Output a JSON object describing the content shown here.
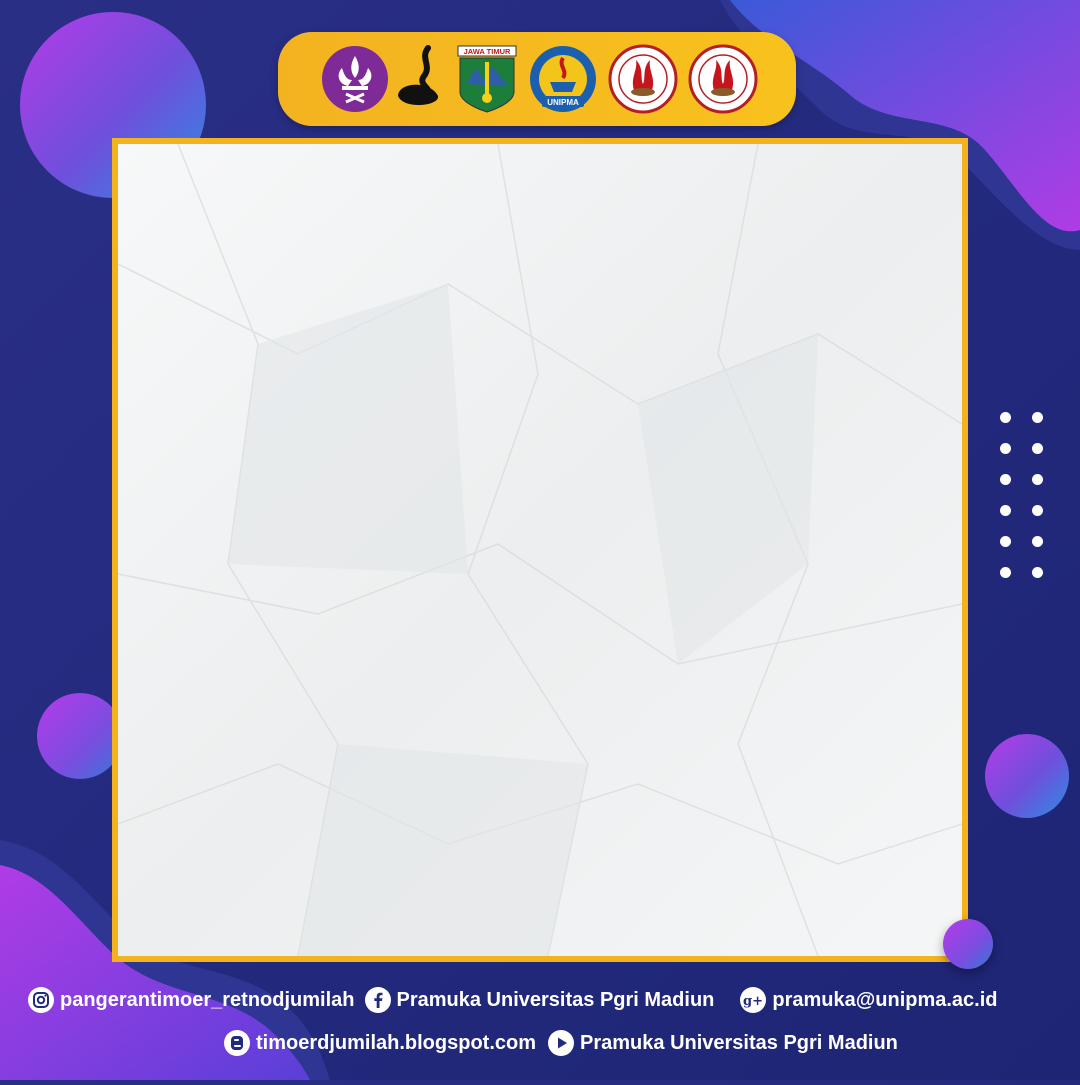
{
  "logo_bar": {
    "logos": [
      {
        "name": "scout-emblem-logo"
      },
      {
        "name": "tunas-kelapa-logo"
      },
      {
        "name": "jawa-timur-logo",
        "text": "JAWA TIMUR"
      },
      {
        "name": "unipma-logo",
        "text": "UNIPMA"
      },
      {
        "name": "seal-logo-1"
      },
      {
        "name": "seal-logo-2"
      }
    ]
  },
  "footer": {
    "instagram": "pangerantimoer_retnodjumilah",
    "facebook": "Pramuka Universitas Pgri Madiun",
    "email": "pramuka@unipma.ac.id",
    "blog": "timoerdjumilah.blogspot.com",
    "youtube": "Pramuka Universitas Pgri Madiun"
  },
  "colors": {
    "background": "#232a7e",
    "accent": "#f2b31e",
    "purple": "#a43ce8",
    "blue": "#2b6fd6"
  }
}
